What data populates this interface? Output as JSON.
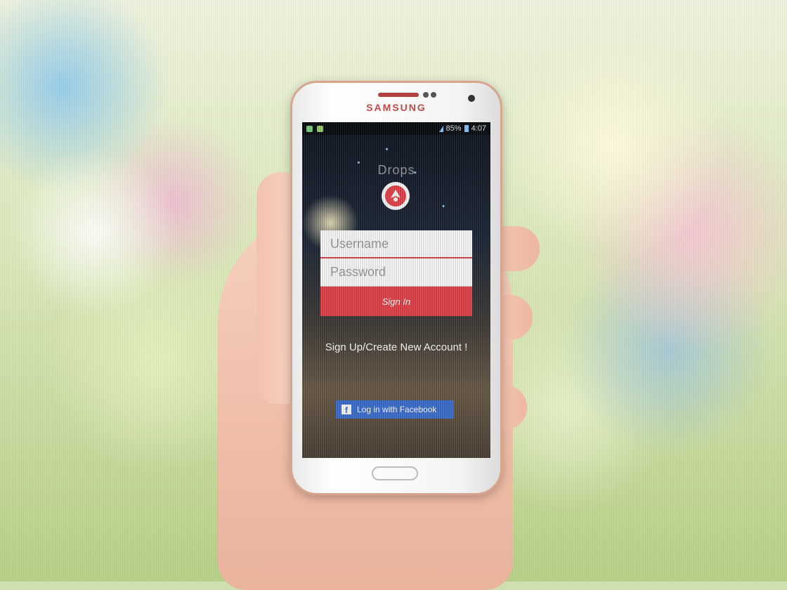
{
  "device": {
    "brand": "SAMSUNG"
  },
  "status_bar": {
    "battery": "85%",
    "time": "4:07"
  },
  "app": {
    "title": "Drops"
  },
  "login": {
    "username_placeholder": "Username",
    "password_placeholder": "Password",
    "sign_in_label": "Sign In",
    "sign_up_label": "Sign Up/Create New Account !",
    "facebook_label": "Log in with Facebook",
    "facebook_icon": "f"
  },
  "colors": {
    "accent_red": "#e8424a",
    "facebook_blue": "#3b6fd1"
  }
}
